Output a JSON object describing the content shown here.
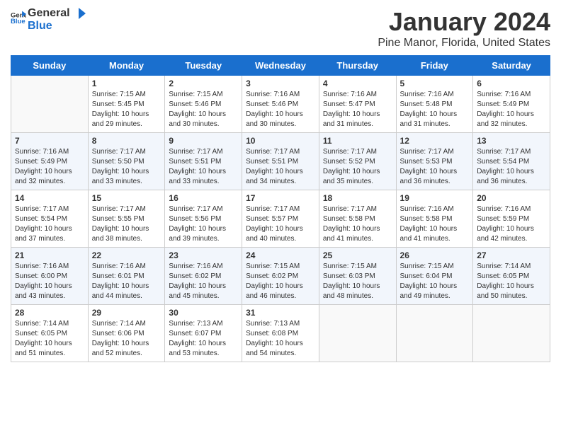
{
  "header": {
    "logo_general": "General",
    "logo_blue": "Blue",
    "title": "January 2024",
    "subtitle": "Pine Manor, Florida, United States"
  },
  "calendar": {
    "days_of_week": [
      "Sunday",
      "Monday",
      "Tuesday",
      "Wednesday",
      "Thursday",
      "Friday",
      "Saturday"
    ],
    "weeks": [
      [
        {
          "day": "",
          "info": ""
        },
        {
          "day": "1",
          "info": "Sunrise: 7:15 AM\nSunset: 5:45 PM\nDaylight: 10 hours\nand 29 minutes."
        },
        {
          "day": "2",
          "info": "Sunrise: 7:15 AM\nSunset: 5:46 PM\nDaylight: 10 hours\nand 30 minutes."
        },
        {
          "day": "3",
          "info": "Sunrise: 7:16 AM\nSunset: 5:46 PM\nDaylight: 10 hours\nand 30 minutes."
        },
        {
          "day": "4",
          "info": "Sunrise: 7:16 AM\nSunset: 5:47 PM\nDaylight: 10 hours\nand 31 minutes."
        },
        {
          "day": "5",
          "info": "Sunrise: 7:16 AM\nSunset: 5:48 PM\nDaylight: 10 hours\nand 31 minutes."
        },
        {
          "day": "6",
          "info": "Sunrise: 7:16 AM\nSunset: 5:49 PM\nDaylight: 10 hours\nand 32 minutes."
        }
      ],
      [
        {
          "day": "7",
          "info": "Sunrise: 7:16 AM\nSunset: 5:49 PM\nDaylight: 10 hours\nand 32 minutes."
        },
        {
          "day": "8",
          "info": "Sunrise: 7:17 AM\nSunset: 5:50 PM\nDaylight: 10 hours\nand 33 minutes."
        },
        {
          "day": "9",
          "info": "Sunrise: 7:17 AM\nSunset: 5:51 PM\nDaylight: 10 hours\nand 33 minutes."
        },
        {
          "day": "10",
          "info": "Sunrise: 7:17 AM\nSunset: 5:51 PM\nDaylight: 10 hours\nand 34 minutes."
        },
        {
          "day": "11",
          "info": "Sunrise: 7:17 AM\nSunset: 5:52 PM\nDaylight: 10 hours\nand 35 minutes."
        },
        {
          "day": "12",
          "info": "Sunrise: 7:17 AM\nSunset: 5:53 PM\nDaylight: 10 hours\nand 36 minutes."
        },
        {
          "day": "13",
          "info": "Sunrise: 7:17 AM\nSunset: 5:54 PM\nDaylight: 10 hours\nand 36 minutes."
        }
      ],
      [
        {
          "day": "14",
          "info": "Sunrise: 7:17 AM\nSunset: 5:54 PM\nDaylight: 10 hours\nand 37 minutes."
        },
        {
          "day": "15",
          "info": "Sunrise: 7:17 AM\nSunset: 5:55 PM\nDaylight: 10 hours\nand 38 minutes."
        },
        {
          "day": "16",
          "info": "Sunrise: 7:17 AM\nSunset: 5:56 PM\nDaylight: 10 hours\nand 39 minutes."
        },
        {
          "day": "17",
          "info": "Sunrise: 7:17 AM\nSunset: 5:57 PM\nDaylight: 10 hours\nand 40 minutes."
        },
        {
          "day": "18",
          "info": "Sunrise: 7:17 AM\nSunset: 5:58 PM\nDaylight: 10 hours\nand 41 minutes."
        },
        {
          "day": "19",
          "info": "Sunrise: 7:16 AM\nSunset: 5:58 PM\nDaylight: 10 hours\nand 41 minutes."
        },
        {
          "day": "20",
          "info": "Sunrise: 7:16 AM\nSunset: 5:59 PM\nDaylight: 10 hours\nand 42 minutes."
        }
      ],
      [
        {
          "day": "21",
          "info": "Sunrise: 7:16 AM\nSunset: 6:00 PM\nDaylight: 10 hours\nand 43 minutes."
        },
        {
          "day": "22",
          "info": "Sunrise: 7:16 AM\nSunset: 6:01 PM\nDaylight: 10 hours\nand 44 minutes."
        },
        {
          "day": "23",
          "info": "Sunrise: 7:16 AM\nSunset: 6:02 PM\nDaylight: 10 hours\nand 45 minutes."
        },
        {
          "day": "24",
          "info": "Sunrise: 7:15 AM\nSunset: 6:02 PM\nDaylight: 10 hours\nand 46 minutes."
        },
        {
          "day": "25",
          "info": "Sunrise: 7:15 AM\nSunset: 6:03 PM\nDaylight: 10 hours\nand 48 minutes."
        },
        {
          "day": "26",
          "info": "Sunrise: 7:15 AM\nSunset: 6:04 PM\nDaylight: 10 hours\nand 49 minutes."
        },
        {
          "day": "27",
          "info": "Sunrise: 7:14 AM\nSunset: 6:05 PM\nDaylight: 10 hours\nand 50 minutes."
        }
      ],
      [
        {
          "day": "28",
          "info": "Sunrise: 7:14 AM\nSunset: 6:05 PM\nDaylight: 10 hours\nand 51 minutes."
        },
        {
          "day": "29",
          "info": "Sunrise: 7:14 AM\nSunset: 6:06 PM\nDaylight: 10 hours\nand 52 minutes."
        },
        {
          "day": "30",
          "info": "Sunrise: 7:13 AM\nSunset: 6:07 PM\nDaylight: 10 hours\nand 53 minutes."
        },
        {
          "day": "31",
          "info": "Sunrise: 7:13 AM\nSunset: 6:08 PM\nDaylight: 10 hours\nand 54 minutes."
        },
        {
          "day": "",
          "info": ""
        },
        {
          "day": "",
          "info": ""
        },
        {
          "day": "",
          "info": ""
        }
      ]
    ]
  }
}
